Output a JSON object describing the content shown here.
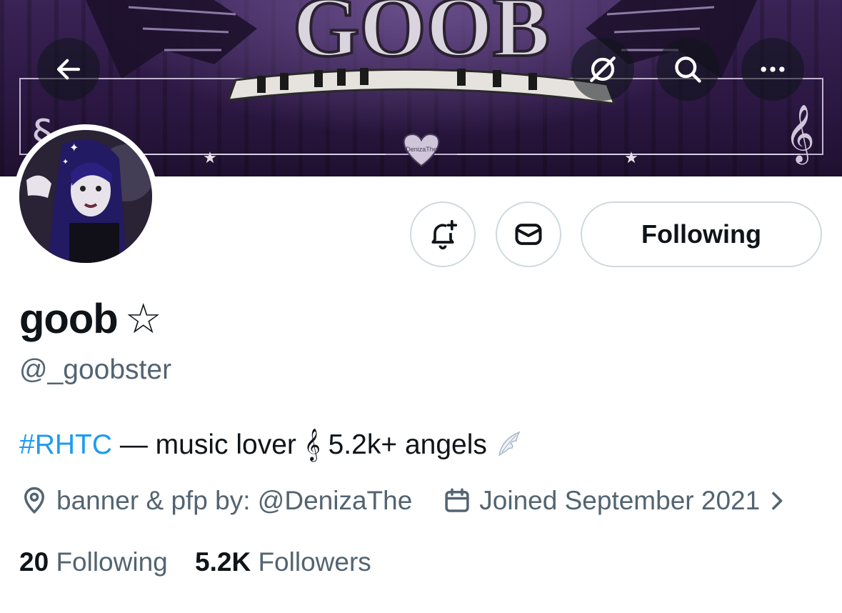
{
  "banner": {
    "logo_text": "GOOB",
    "signature": "DenizaThe"
  },
  "nav": {
    "back_icon": "arrow-left-icon",
    "grok_icon": "grok-icon",
    "search_icon": "search-icon",
    "more_icon": "ellipsis-icon"
  },
  "actions": {
    "notify_icon": "bell-plus-icon",
    "message_icon": "envelope-icon",
    "follow_label": "Following"
  },
  "profile": {
    "display_name": "goob",
    "name_suffix": "☆",
    "handle": "@_goobster",
    "bio": {
      "hashtag": "#RHTC",
      "text": " — music lover 𝄞 5.2k+ angels ",
      "emoji": "wing-icon"
    },
    "location": "banner & pfp by: @DenizaThe",
    "joined": "Joined September 2021"
  },
  "stats": {
    "following_count": "20",
    "following_label": "Following",
    "followers_count": "5.2K",
    "followers_label": "Followers"
  },
  "colors": {
    "accent": "#1d9bf0",
    "secondary_text": "#536471",
    "primary_text": "#0f1419",
    "border": "#cfd9de",
    "banner_purple": "#2b1741"
  }
}
